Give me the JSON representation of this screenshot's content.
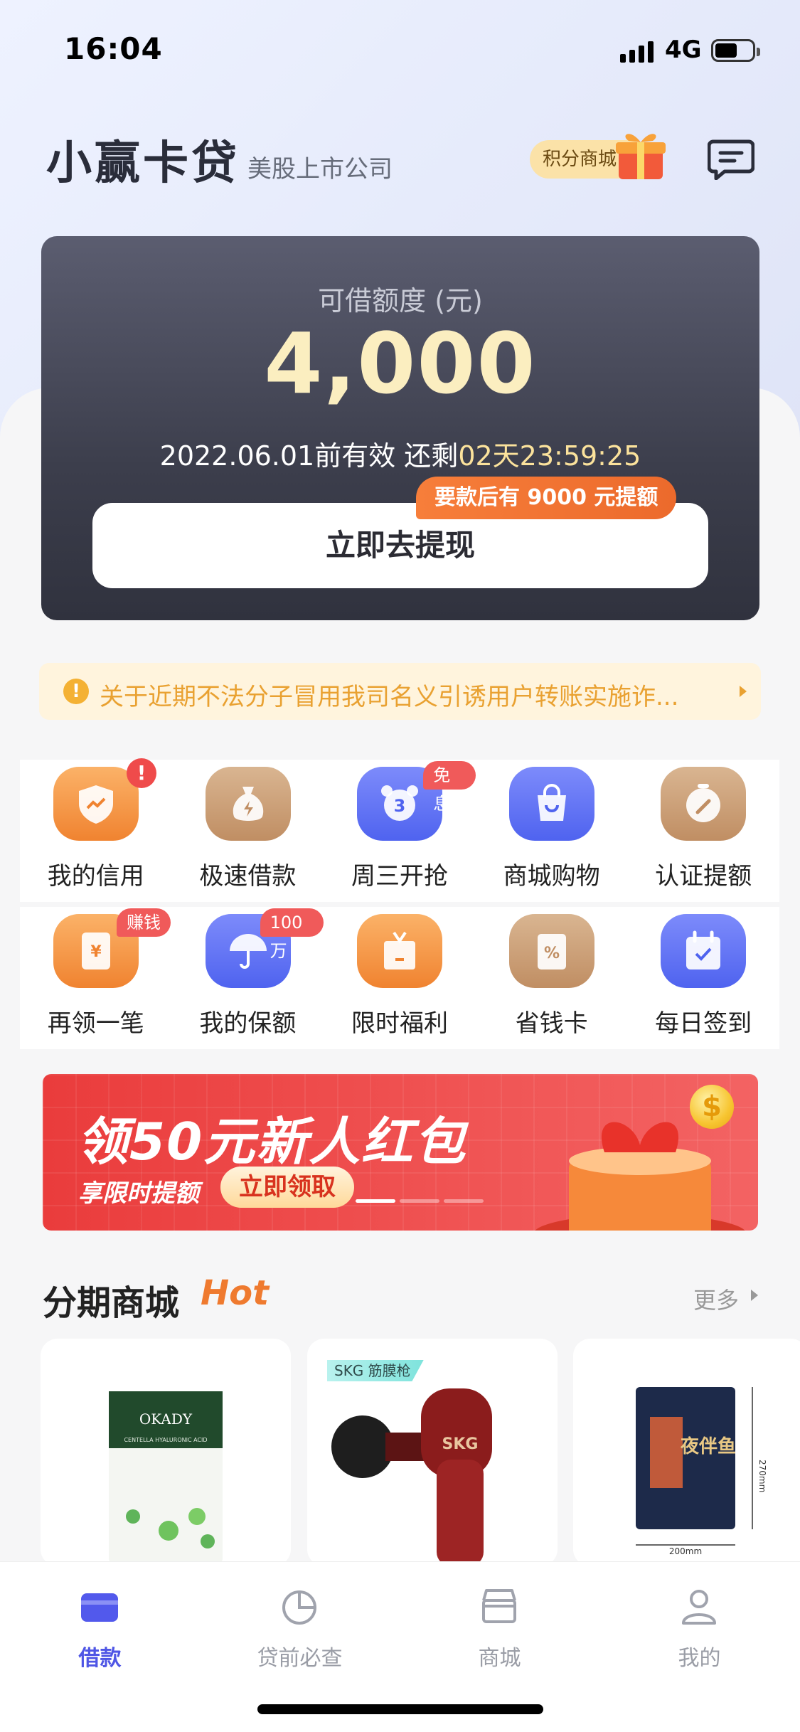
{
  "status_bar": {
    "time": "16:04",
    "network": "4G"
  },
  "header": {
    "app_name": "小赢卡贷",
    "subtitle": "美股上市公司",
    "points_mall": "积分商城"
  },
  "loan_card": {
    "label": "可借额度 (元)",
    "amount": "4,000",
    "validity_prefix": "2022.06.01前有效 还剩",
    "countdown": "02天23:59:25",
    "tag": "要款后有 9000 元提额",
    "withdraw_button": "立即去提现"
  },
  "notice": {
    "text": "关于近期不法分子冒用我司名义引诱用户转账实施诈..."
  },
  "grid": {
    "row1": [
      {
        "label": "我的信用",
        "icon": "credit-shield-icon",
        "badge": "!"
      },
      {
        "label": "极速借款",
        "icon": "money-bag-icon"
      },
      {
        "label": "周三开抢",
        "icon": "alarm-clock-icon",
        "badge": "免息"
      },
      {
        "label": "商城购物",
        "icon": "shopping-bag-icon"
      },
      {
        "label": "认证提额",
        "icon": "gauge-icon"
      }
    ],
    "row2": [
      {
        "label": "再领一笔",
        "icon": "yen-envelope-icon",
        "badge": "赚钱"
      },
      {
        "label": "我的保额",
        "icon": "umbrella-icon",
        "badge": "100万"
      },
      {
        "label": "限时福利",
        "icon": "gift-box-icon"
      },
      {
        "label": "省钱卡",
        "icon": "percent-card-icon"
      },
      {
        "label": "每日签到",
        "icon": "calendar-check-icon"
      }
    ]
  },
  "banner": {
    "title": "领50元新人红包",
    "subtitle": "享限时提额",
    "button": "立即领取",
    "coin_symbol": "$"
  },
  "mall": {
    "title": "分期商城",
    "hot": "Hot",
    "more": "更多",
    "products": [
      {
        "brand": "OKADY",
        "name": "CENTELLA HYALURONIC ACID"
      },
      {
        "brand": "SKG",
        "tag": "SKG 筋膜枪"
      },
      {
        "brand": "夜伴鱼",
        "dims_w": "200mm",
        "dims_h": "270mm"
      }
    ]
  },
  "tabbar": {
    "tabs": [
      {
        "label": "借款",
        "active": true
      },
      {
        "label": "贷前必查",
        "active": false
      },
      {
        "label": "商城",
        "active": false
      },
      {
        "label": "我的",
        "active": false
      }
    ]
  },
  "colors": {
    "accent": "#4f56e5",
    "card_dark": "#3c3e4c",
    "amount_gold": "#fbeec0",
    "banner_red": "#ea3c3c",
    "orange": "#f08330"
  }
}
